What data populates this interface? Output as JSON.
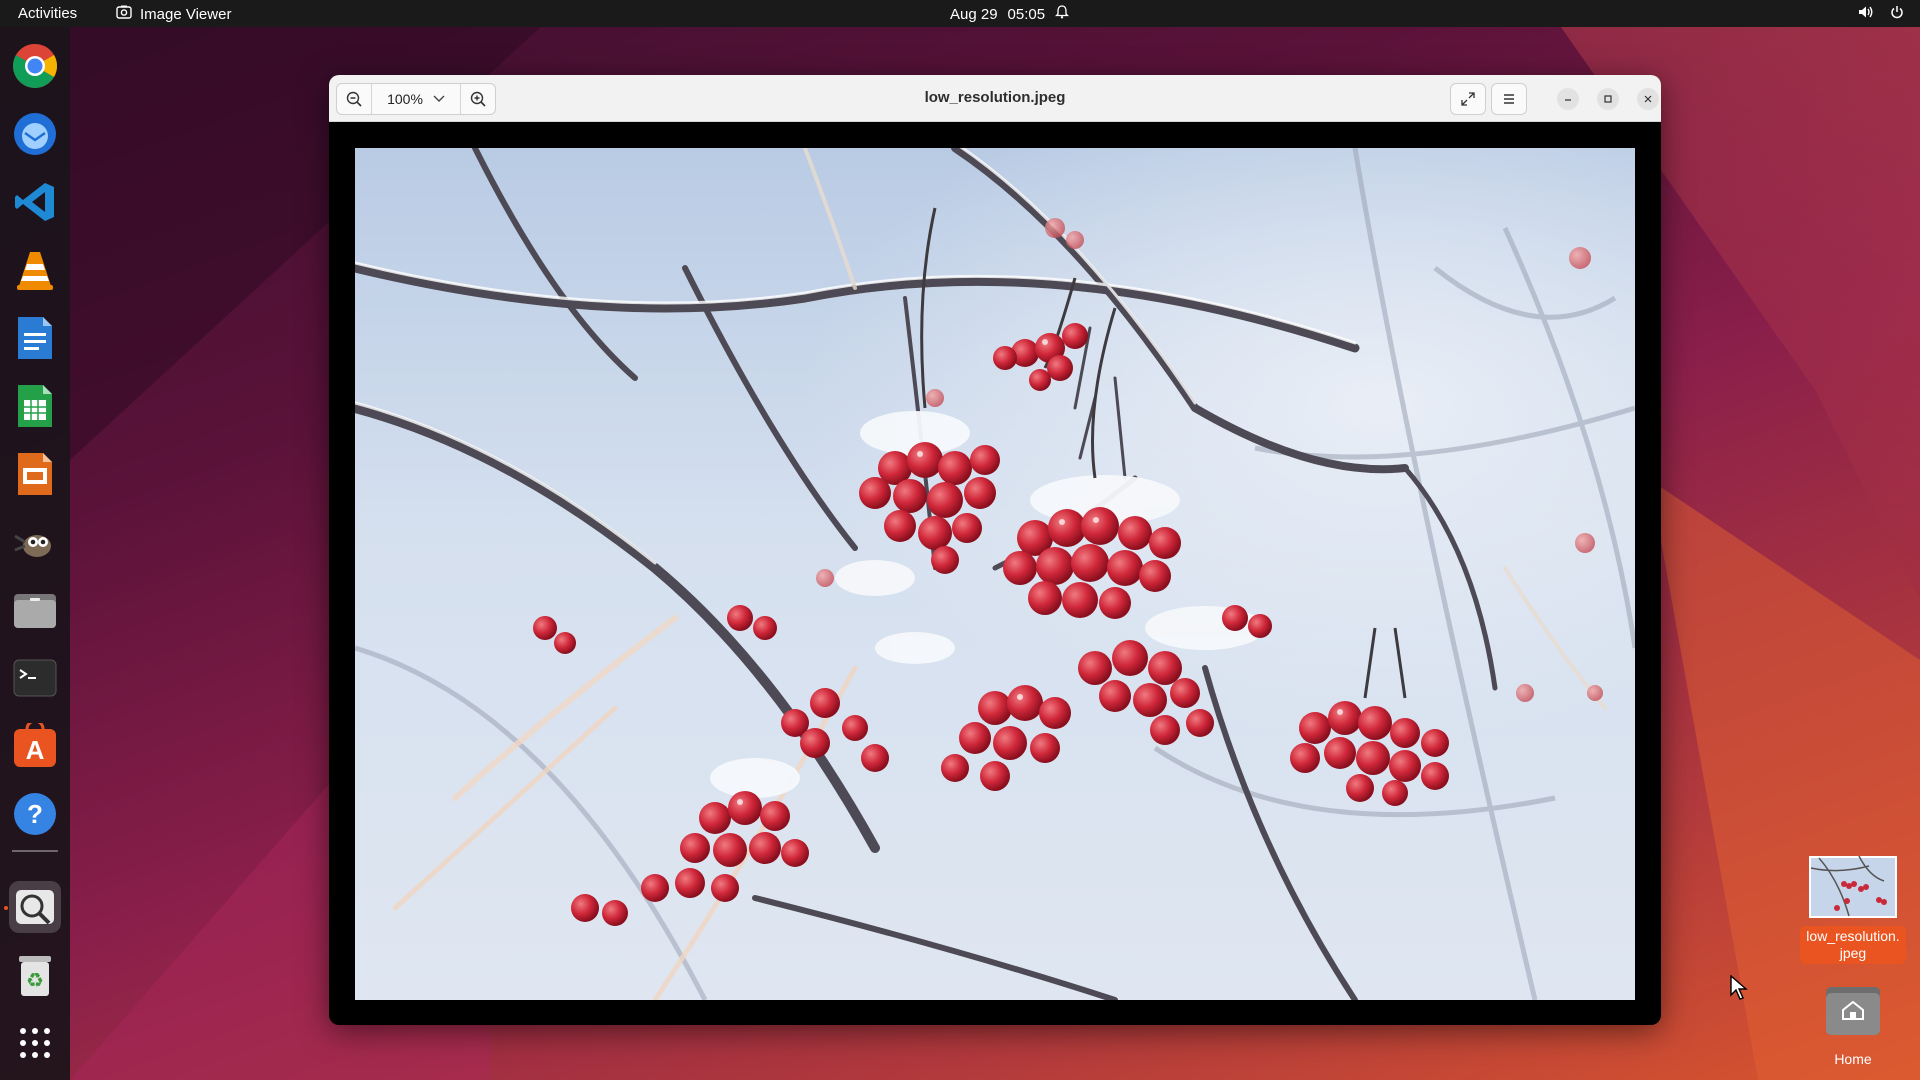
{
  "topbar": {
    "activities": "Activities",
    "app_name": "Image Viewer",
    "date": "Aug 29",
    "time": "05:05"
  },
  "dock": {
    "items": [
      "Chrome",
      "Thunderbird",
      "VS Code",
      "VLC",
      "LibreOffice Writer",
      "LibreOffice Calc",
      "LibreOffice Impress",
      "GIMP",
      "Files",
      "Terminal",
      "App Center",
      "Help",
      "Image Viewer",
      "Trash",
      "Show Applications"
    ]
  },
  "window": {
    "title": "low_resolution.jpeg",
    "zoom": "100%"
  },
  "desktop": {
    "file_label": "low_resolution.\njpeg",
    "home_label": "Home"
  },
  "colors": {
    "accent": "#e95420",
    "topbar": "#1a1a1a",
    "headerbar": "#f2f2f2"
  }
}
